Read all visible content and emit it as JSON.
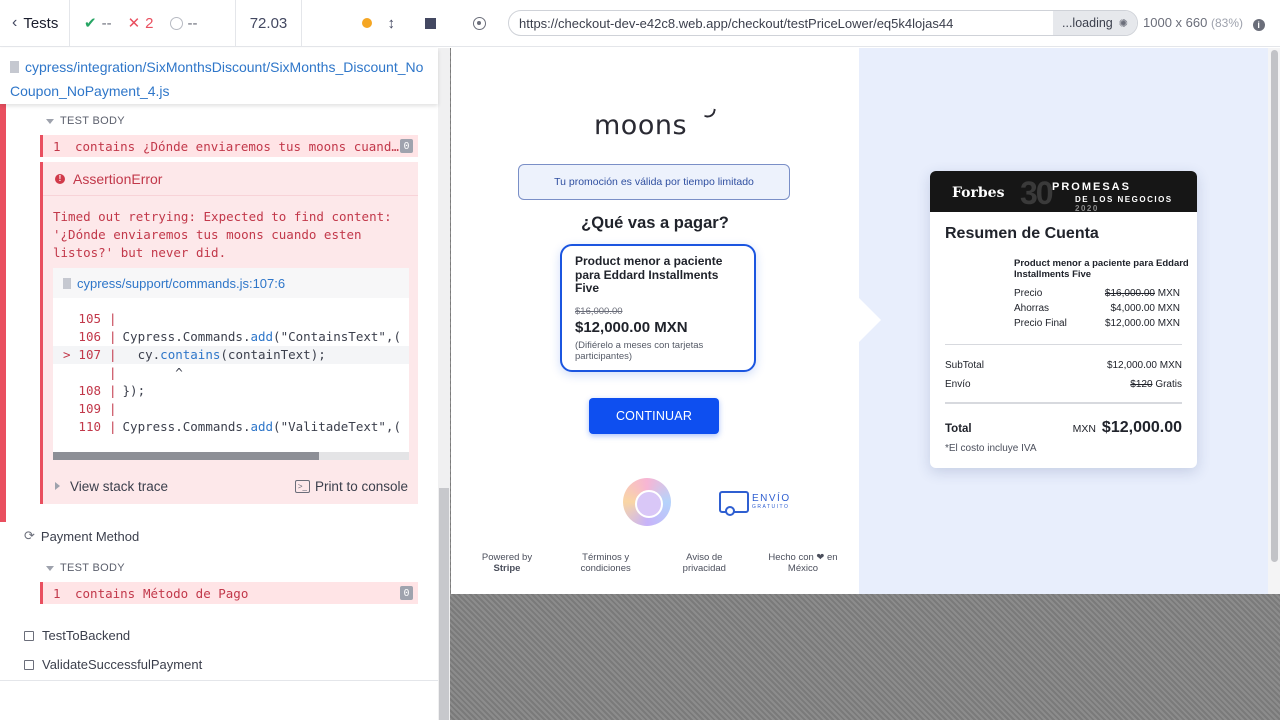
{
  "reporter": {
    "header": {
      "tests_label": "Tests",
      "passed": "--",
      "failed": "2",
      "pending": "--",
      "duration": "72.03"
    },
    "spec_path": "cypress/integration/SixMonthsDiscount/SixMonths_Discount_NoCoupon_NoPayment_4.js",
    "test_body_label": "TEST BODY",
    "failed_command": {
      "num": "1",
      "name": "contains",
      "message": "¿Dónde enviaremos tus moons cuando esten listos?",
      "badge": "0"
    },
    "error": {
      "title": "AssertionError",
      "message": "Timed out retrying: Expected to find content:\n'¿Dónde enviaremos tus moons cuando esten\nlistos?' but never did.",
      "file": "cypress/support/commands.js:107:6",
      "code_lines": [
        {
          "gutter": "105",
          "marker": "",
          "text": ""
        },
        {
          "gutter": "106",
          "marker": "",
          "pre": "Cypress.Commands.",
          "fn": "add",
          "post": "(\"ContainsText\",("
        },
        {
          "gutter": "107",
          "marker": "> ",
          "pre": "  cy.",
          "fn": "contains",
          "post": "(containText);"
        },
        {
          "gutter": "",
          "marker": "",
          "text": "       ^"
        },
        {
          "gutter": "108",
          "marker": "",
          "text": "});"
        },
        {
          "gutter": "109",
          "marker": "",
          "text": ""
        },
        {
          "gutter": "110",
          "marker": "",
          "pre": "Cypress.Commands.",
          "fn": "add",
          "post": "(\"ValitadeText\",("
        }
      ],
      "stack_label": "View stack trace",
      "print_label": "Print to console"
    },
    "tests": [
      {
        "title": "Payment Method",
        "state": "running"
      },
      {
        "title": "TestToBackend",
        "state": "pending"
      },
      {
        "title": "ValidateSuccessfulPayment",
        "state": "pending"
      }
    ],
    "payment_command": {
      "num": "1",
      "name": "contains",
      "message": "Método de Pago",
      "badge": "0"
    }
  },
  "aut": {
    "url": "https://checkout-dev-e42c8.web.app/checkout/testPriceLower/eq5k4lojas44",
    "loading_label": "...loading",
    "viewport": "1000 x 660",
    "zoom": "(83%)"
  },
  "checkout": {
    "logo": "moons",
    "promo": "Tu promoción es válida por tiempo limitado",
    "heading": "¿Qué vas a pagar?",
    "product": {
      "name": "Product menor a paciente para Eddard Installments Five",
      "old_price": "$16,000.00",
      "new_price": "$12,000.00 MXN",
      "note": "(Difiérelo a meses con tarjetas participantes)"
    },
    "continue_label": "CONTINUAR",
    "envio": {
      "main": "ENVÍO",
      "sub": "GRATUITO"
    },
    "footer": [
      {
        "line1": "Powered by",
        "line2": "Stripe",
        "bold2": true
      },
      {
        "line1": "Términos y",
        "line2": "condiciones",
        "bold2": false
      },
      {
        "line1": "Aviso de",
        "line2": "privacidad",
        "bold2": false
      },
      {
        "line1": "Hecho con ❤ en",
        "line2": "México",
        "bold2": false
      }
    ],
    "summary": {
      "banner_brand": "Forbes",
      "banner_number": "30",
      "banner_line1": "PROMESAS",
      "banner_line2": "DE LOS NEGOCIOS",
      "banner_year": "2020",
      "title": "Resumen de Cuenta",
      "product_name": "Product menor a paciente para Eddard Installments Five",
      "precio_label": "Precio",
      "precio_strike": "$16,000.00",
      "precio_cur": "MXN",
      "ahorras_label": "Ahorras",
      "ahorras_value": "$4,000.00 MXN",
      "final_label": "Precio Final",
      "final_value": "$12,000.00 MXN",
      "subtotal_label": "SubTotal",
      "subtotal_value": "$12,000.00 MXN",
      "envio_label": "Envío",
      "envio_strike": "$120",
      "envio_value": "Gratis",
      "total_label": "Total",
      "total_currency": "MXN",
      "total_value": "$12,000.00",
      "iva_note": "*El costo incluye IVA"
    }
  }
}
